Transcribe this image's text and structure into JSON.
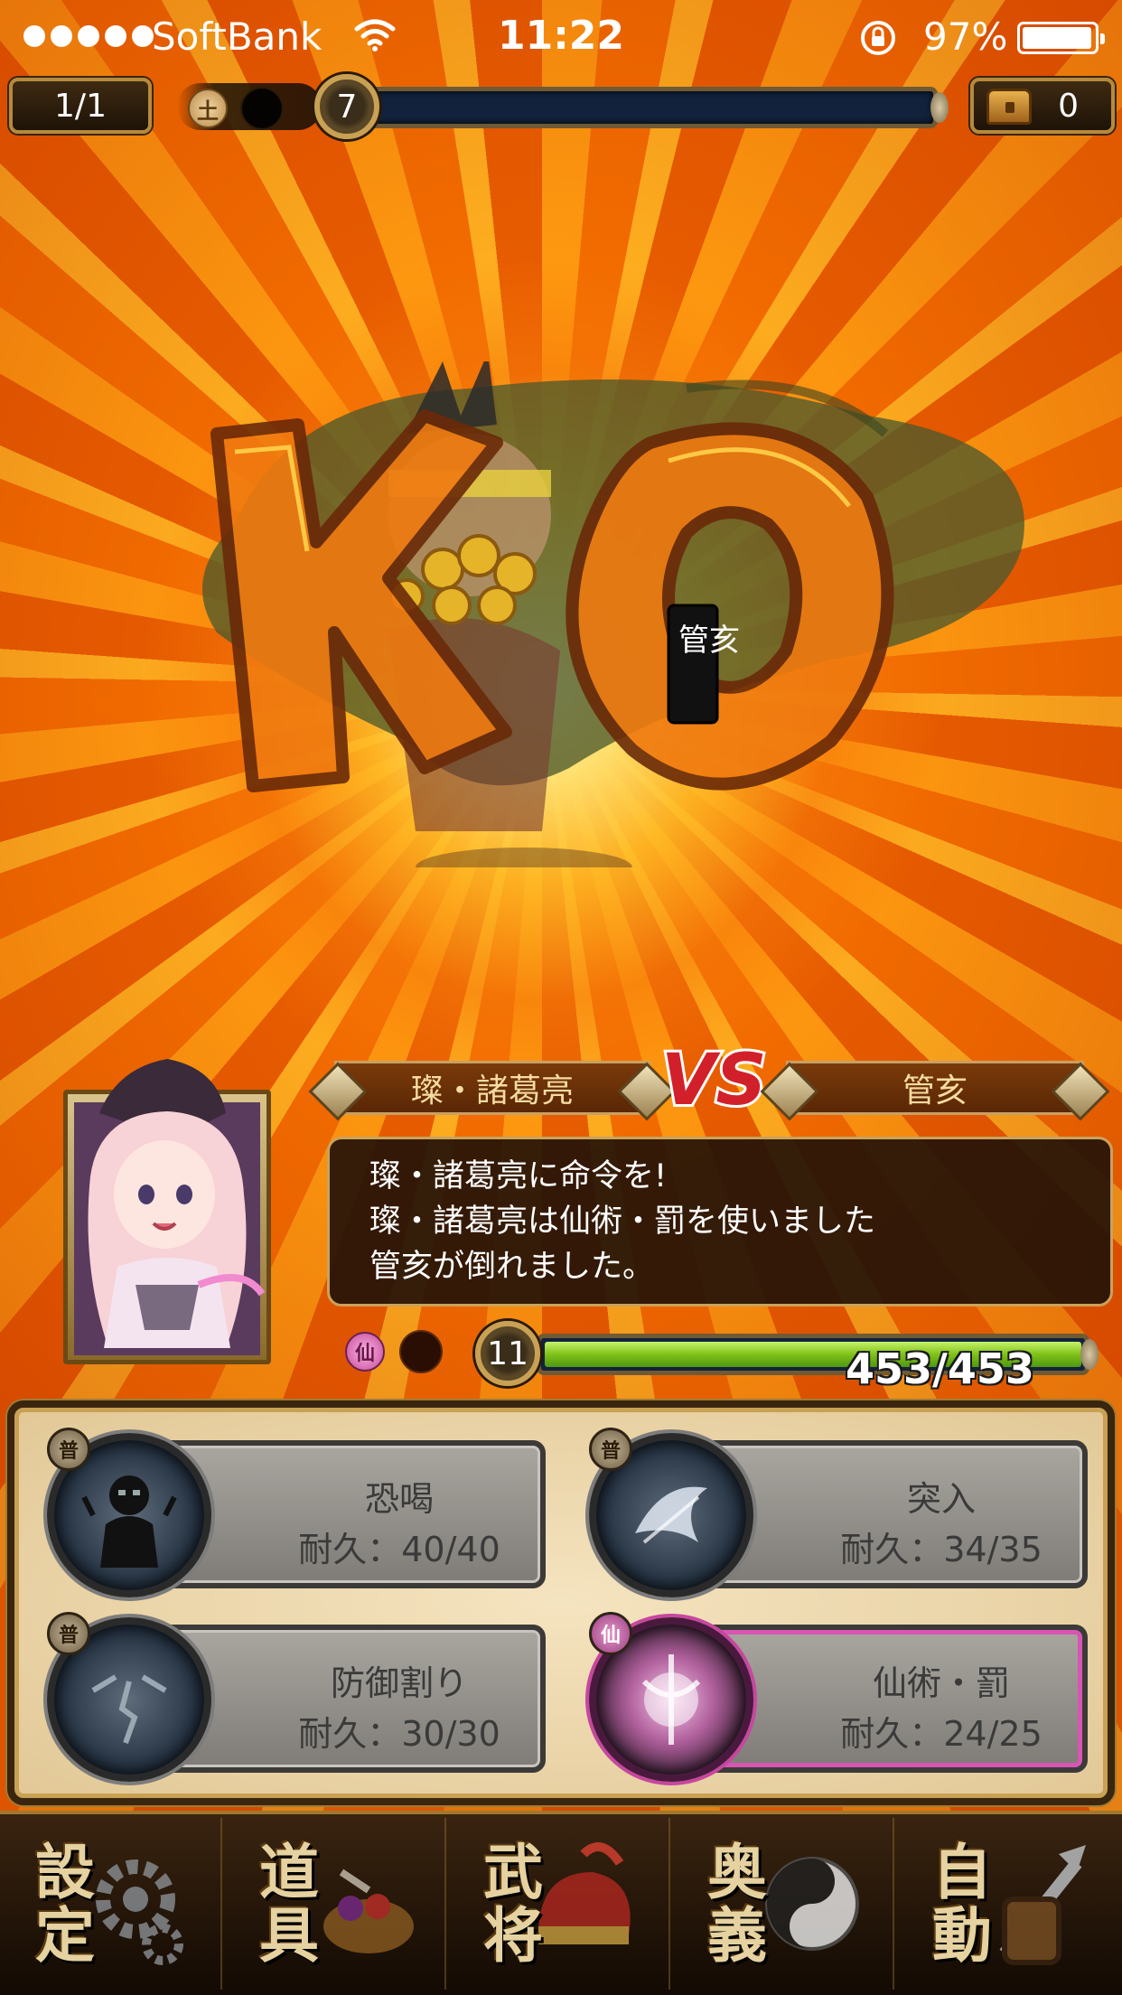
{
  "status_bar": {
    "carrier": "SoftBank",
    "time": "11:22",
    "battery": "97%"
  },
  "hud": {
    "stage": "1/1",
    "element_icon": "土",
    "enemy_level": "7",
    "chest_count": "0"
  },
  "battle": {
    "player_name": "璨・諸葛亮",
    "vs_label": "VS",
    "enemy_name": "管亥",
    "messages": [
      "璨・諸葛亮に命令を!",
      "璨・諸葛亮は仙術・罰を使いました",
      "管亥が倒れました。"
    ],
    "player_element_icon": "仙",
    "player_level": "11",
    "hp_text": "453/453",
    "hp_fraction": 1.0,
    "enemy_hp_fraction": 0.0
  },
  "skills": [
    {
      "badge": "普",
      "name": "恐喝",
      "durability": "耐久：40/40",
      "icon": "shadow-figure-icon"
    },
    {
      "badge": "普",
      "name": "突入",
      "durability": "耐久：34/35",
      "icon": "charge-icon"
    },
    {
      "badge": "普",
      "name": "防御割り",
      "durability": "耐久：30/30",
      "icon": "shield-break-icon"
    },
    {
      "badge": "仙",
      "name": "仙術・罰",
      "durability": "耐久：24/25",
      "icon": "punishment-icon"
    }
  ],
  "menu": [
    {
      "label": "設定",
      "icon": "gear-icon"
    },
    {
      "label": "道具",
      "icon": "item-bag-icon"
    },
    {
      "label": "武将",
      "icon": "helmet-icon"
    },
    {
      "label": "奥義",
      "icon": "yin-yang-icon"
    },
    {
      "label": "自動",
      "icon": "sword-shield-icon"
    }
  ],
  "colors": {
    "accent_gold": "#c9a154",
    "hp_green": "#7fc219",
    "sen_pink": "#d855b4",
    "background_orange": "#f08a10"
  }
}
